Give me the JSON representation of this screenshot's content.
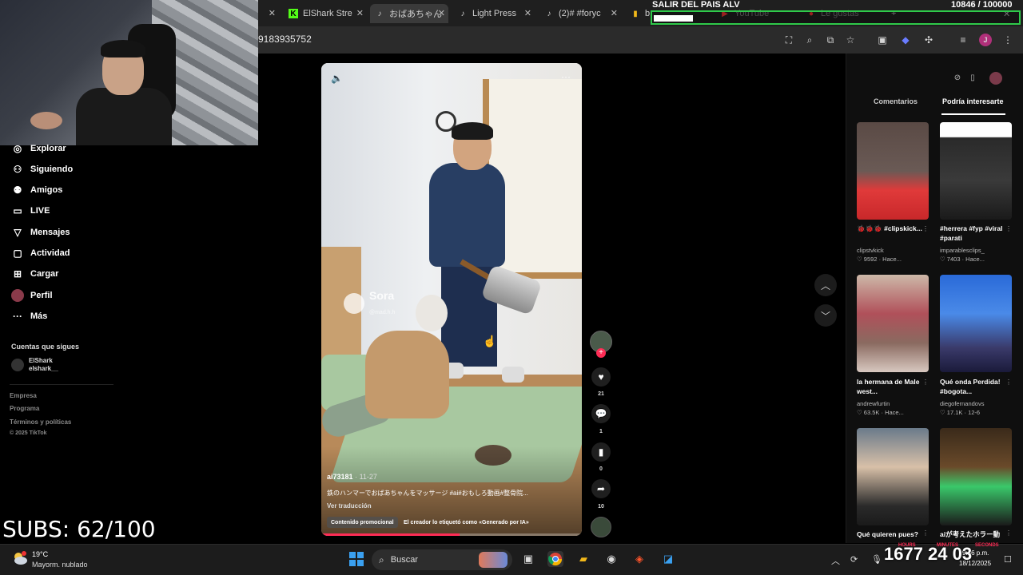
{
  "browser": {
    "tabs": [
      {
        "label": "ElShark Stre",
        "icon": "kick-icon",
        "active": false
      },
      {
        "label": "おばあちゃん",
        "icon": "tiktok-icon",
        "active": true
      },
      {
        "label": "Light Press",
        "icon": "tiktok-icon",
        "active": false
      },
      {
        "label": "(2)# #foryc",
        "icon": "tiktok-icon",
        "active": false
      },
      {
        "label": "b",
        "icon": "bookmark-icon",
        "active": false
      }
    ],
    "bookmarks_overlay": [
      "YouTube",
      "Le gustas"
    ],
    "url": "9183935752"
  },
  "stream": {
    "goal_title": "SALIR DEL PAIS ALV",
    "goal_count": "10846  / 100000",
    "goal_progress": 0.108,
    "subs": "SUBS: 62/100",
    "timer": "1677 24 03",
    "timer_labels": [
      "HOURS",
      "MINUTES",
      "SECONDS"
    ]
  },
  "sidebar": {
    "items": [
      {
        "label": "Explorar",
        "icon": "compass-icon"
      },
      {
        "label": "Siguiendo",
        "icon": "following-icon"
      },
      {
        "label": "Amigos",
        "icon": "friends-icon"
      },
      {
        "label": "LIVE",
        "icon": "live-icon"
      },
      {
        "label": "Mensajes",
        "icon": "messages-icon"
      },
      {
        "label": "Actividad",
        "icon": "activity-icon"
      },
      {
        "label": "Cargar",
        "icon": "upload-icon"
      },
      {
        "label": "Perfil",
        "icon": "profile-avatar"
      },
      {
        "label": "Más",
        "icon": "more-icon"
      }
    ],
    "following_header": "Cuentas que sigues",
    "following": [
      {
        "name": "ElShark",
        "handle": "elshark__"
      }
    ],
    "footer": [
      "Empresa",
      "Programa",
      "Términos y políticas",
      "© 2025 TikTok"
    ]
  },
  "video": {
    "watermark": "Sora",
    "watermark_handle": "@mad.h.h",
    "author": "ai73181",
    "date": "11-27",
    "description": "鉄のハンマーでおばあちゃんをマッサージ #ai#おもしろ動画#整骨院...",
    "translate": "Ver traducción",
    "tag_promo": "Contenido promocional",
    "tag_ai": "El creador lo etiquetó como «Generado por IA»",
    "progress": 0.53
  },
  "actions": {
    "likes": "21",
    "comments": "1",
    "saves": "0",
    "shares": "10"
  },
  "right_panel": {
    "tabs": [
      "Comentarios",
      "Podría interesarte"
    ],
    "active_tab": 1,
    "cards": [
      {
        "title": "🐞🐞🐞 #clipskick...",
        "author": "clipstvkick",
        "meta": "♡ 9592 · Hace..."
      },
      {
        "title": "#herrera #fyp #viral #parati",
        "author": "imparablesclips_",
        "meta": "♡ 7403 · Hace..."
      },
      {
        "title": "la hermana de Male west...",
        "author": "andrewfurtin",
        "meta": "♡ 63.5K · Hace..."
      },
      {
        "title": "Qué onda Perdida! #bogota...",
        "author": "diegofernandovs",
        "meta": "♡ 17.1K · 12-6"
      },
      {
        "title": "Qué quieren pues?",
        "author": "",
        "meta": ""
      },
      {
        "title": "aiが考えたホラー動",
        "author": "",
        "meta": ""
      }
    ]
  },
  "taskbar": {
    "weather_temp": "19°C",
    "weather_desc": "Mayorm. nublado",
    "search": "Buscar",
    "clock_time": "9:46 p.m.",
    "clock_date": "18/12/2025"
  }
}
